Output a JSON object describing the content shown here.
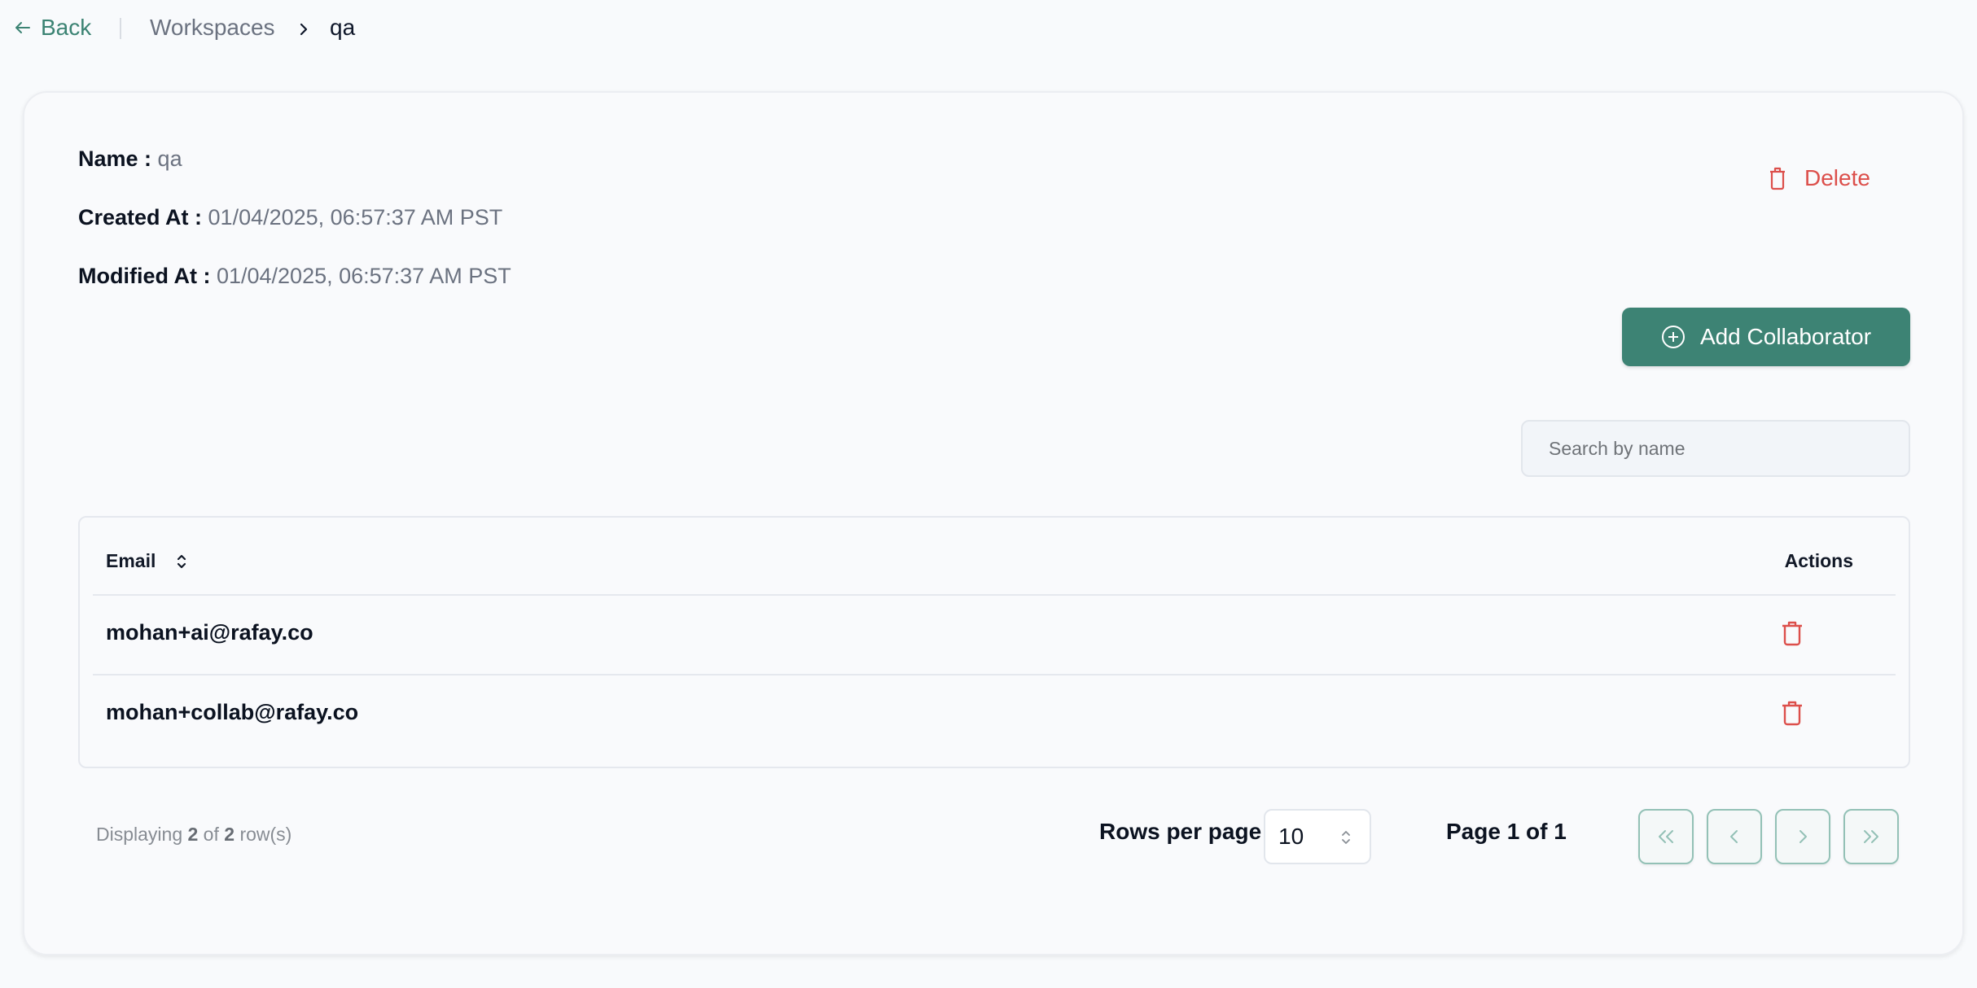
{
  "topbar": {
    "back_label": "Back",
    "breadcrumb": {
      "parent": "Workspaces",
      "current": "qa"
    }
  },
  "details": {
    "name_label": "Name : ",
    "name_value": "qa",
    "created_label": "Created At : ",
    "created_value": "01/04/2025, 06:57:37 AM PST",
    "modified_label": "Modified At : ",
    "modified_value": "01/04/2025, 06:57:37 AM PST"
  },
  "actions": {
    "delete_label": "Delete",
    "add_collaborator_label": "Add Collaborator"
  },
  "search": {
    "placeholder": "Search by name",
    "value": ""
  },
  "table": {
    "columns": [
      "Email",
      "Actions"
    ],
    "rows": [
      {
        "email": "mohan+ai@rafay.co"
      },
      {
        "email": "mohan+collab@rafay.co"
      }
    ]
  },
  "pagination": {
    "displaying_prefix": "Displaying ",
    "shown": "2",
    "of_text": " of ",
    "total": "2",
    "suffix": " row(s)",
    "rows_per_page_label": "Rows per page",
    "rows_per_page_value": "10",
    "page_info": "Page 1 of 1"
  },
  "colors": {
    "primary": "#3d8374",
    "danger": "#dc4f4b",
    "link": "#3b8373"
  }
}
